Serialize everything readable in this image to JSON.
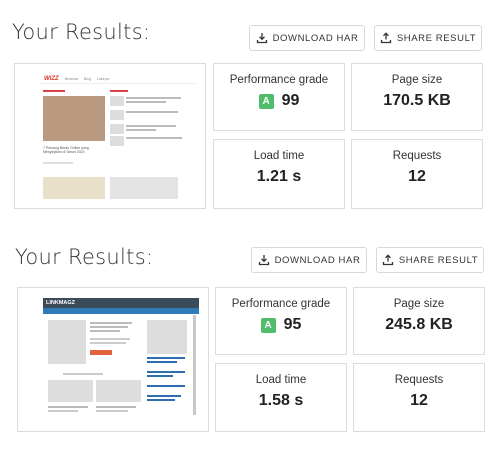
{
  "results": [
    {
      "title": "Your Results:",
      "download_har_label": "DOWNLOAD HAR",
      "share_result_label": "SHARE RESULT",
      "thumbnail": {
        "logo": "WIZZ",
        "nav": [
          "Beranda",
          "Blog",
          "Lainnya"
        ],
        "headline": "7 Peluang Bisnis Online yang Menjanjikan di Tahun 2024"
      },
      "performance_grade_label": "Performance grade",
      "grade_letter": "A",
      "grade_value": "99",
      "page_size_label": "Page size",
      "page_size_value": "170.5 KB",
      "load_time_label": "Load time",
      "load_time_value": "1.21 s",
      "requests_label": "Requests",
      "requests_value": "12"
    },
    {
      "title": "Your Results:",
      "download_har_label": "DOWNLOAD HAR",
      "share_result_label": "SHARE RESULT",
      "thumbnail": {
        "logo": "LINKMAGZ"
      },
      "performance_grade_label": "Performance grade",
      "grade_letter": "A",
      "grade_value": "95",
      "page_size_label": "Page size",
      "page_size_value": "245.8 KB",
      "load_time_label": "Load time",
      "load_time_value": "1.58 s",
      "requests_label": "Requests",
      "requests_value": "12"
    }
  ],
  "colors": {
    "grade_badge": "#4fbd6c",
    "card_border": "#dcdcdc",
    "nav_dark": "#3c4b5a",
    "nav_blue": "#2f7ab8"
  },
  "icons": {
    "download": "download-icon",
    "share": "share-icon"
  }
}
